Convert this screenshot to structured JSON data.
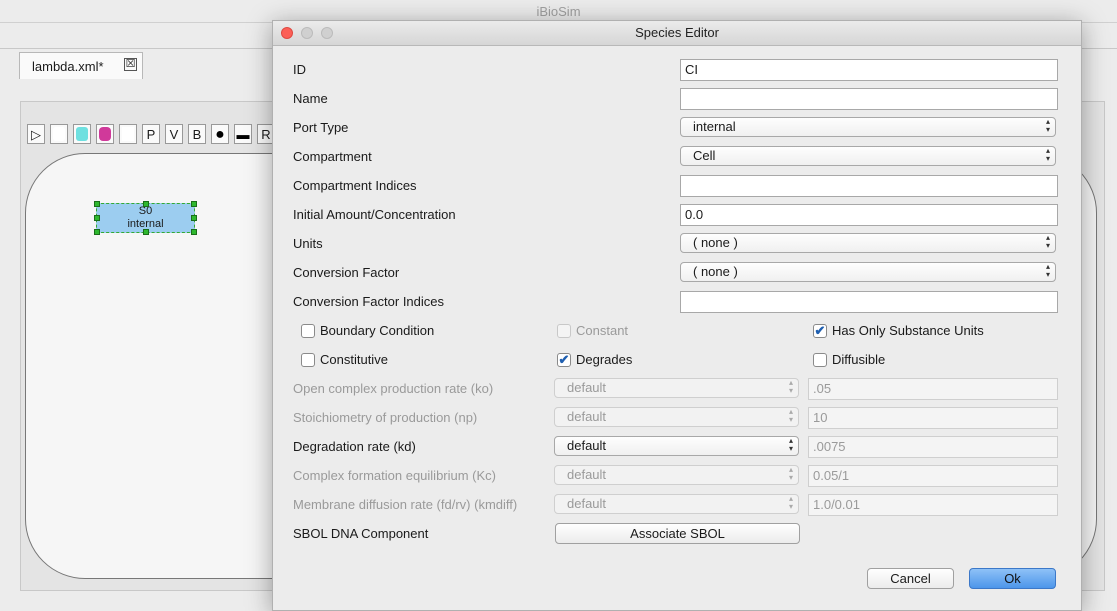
{
  "app": {
    "title": "iBioSim"
  },
  "document_tab": {
    "label": "lambda.xml*",
    "close_glyph": "☒"
  },
  "toolbar": {
    "items": [
      {
        "name": "select-tool",
        "glyph": "▷"
      },
      {
        "name": "compartment-tool",
        "glyph": ""
      },
      {
        "name": "species-tool",
        "glyph": ""
      },
      {
        "name": "reaction-tool",
        "glyph": ""
      },
      {
        "name": "component-tool",
        "glyph": ""
      },
      {
        "name": "promoter-tool",
        "glyph": "P"
      },
      {
        "name": "variable-tool",
        "glyph": "V"
      },
      {
        "name": "boolean-tool",
        "glyph": "B"
      },
      {
        "name": "event-tool",
        "glyph": "●"
      },
      {
        "name": "rule-tool",
        "glyph": "▬"
      },
      {
        "name": "r-tool",
        "glyph": "R"
      }
    ]
  },
  "canvas": {
    "species_node": {
      "id": "S0",
      "type": "internal"
    }
  },
  "dialog": {
    "title": "Species Editor",
    "fields": {
      "id": {
        "label": "ID",
        "value": "CI"
      },
      "name": {
        "label": "Name",
        "value": ""
      },
      "port_type": {
        "label": "Port Type",
        "value": "internal"
      },
      "compartment": {
        "label": "Compartment",
        "value": "Cell"
      },
      "compartment_indices": {
        "label": "Compartment Indices",
        "value": ""
      },
      "initial_amount": {
        "label": "Initial Amount/Concentration",
        "value": "0.0"
      },
      "units": {
        "label": "Units",
        "value": "( none )"
      },
      "conversion_factor": {
        "label": "Conversion Factor",
        "value": "( none )"
      },
      "conversion_factor_indices": {
        "label": "Conversion Factor Indices",
        "value": ""
      }
    },
    "checkboxes": {
      "boundary_condition": {
        "label": "Boundary Condition",
        "checked": false
      },
      "constant": {
        "label": "Constant",
        "checked": false
      },
      "has_only_substance_units": {
        "label": "Has Only Substance Units",
        "checked": true
      },
      "constitutive": {
        "label": "Constitutive",
        "checked": false
      },
      "degrades": {
        "label": "Degrades",
        "checked": true
      },
      "diffusible": {
        "label": "Diffusible",
        "checked": false
      }
    },
    "rates": [
      {
        "label": "Open complex production rate (ko)",
        "select": "default",
        "value": ".05",
        "enabled": false
      },
      {
        "label": "Stoichiometry of production (np)",
        "select": "default",
        "value": "10",
        "enabled": false
      },
      {
        "label": "Degradation rate (kd)",
        "select": "default",
        "value": ".0075",
        "enabled": true
      },
      {
        "label": "Complex formation equilibrium (Kc)",
        "select": "default",
        "value": "0.05/1",
        "enabled": false
      },
      {
        "label": "Membrane diffusion rate (fd/rv) (kmdiff)",
        "select": "default",
        "value": "1.0/0.01",
        "enabled": false
      }
    ],
    "sbol": {
      "label": "SBOL DNA Component",
      "button": "Associate SBOL"
    },
    "buttons": {
      "cancel": "Cancel",
      "ok": "Ok"
    }
  },
  "colors": {
    "species_fill": "#9ccdf0",
    "handle": "#2eb82e",
    "ok_button": "#4d96ea",
    "check": "#1f5fb0"
  }
}
